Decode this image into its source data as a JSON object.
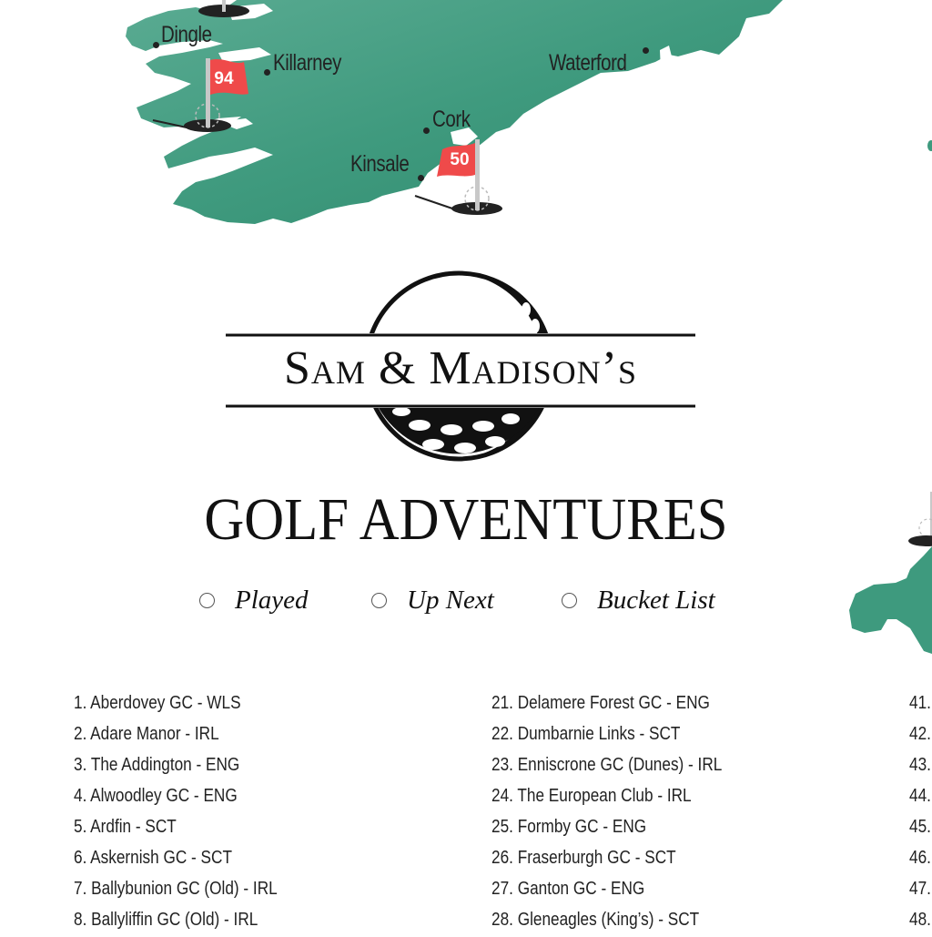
{
  "map": {
    "land_color": "#3e9a7e",
    "flag_color": "#ef4a4a",
    "cities": [
      {
        "name": "Dingle"
      },
      {
        "name": "Killarney"
      },
      {
        "name": "Waterford"
      },
      {
        "name": "Cork"
      },
      {
        "name": "Kinsale"
      }
    ],
    "flags": [
      {
        "number": "94"
      },
      {
        "number": "50"
      }
    ]
  },
  "header": {
    "names": "Sam & Madison’s",
    "title": "GOLF ADVENTURES"
  },
  "legend": [
    {
      "label": "Played",
      "checked": false
    },
    {
      "label": "Up Next",
      "checked": false
    },
    {
      "label": "Bucket List",
      "checked": false
    }
  ],
  "courses": {
    "column1": [
      "1. Aberdovey GC - WLS",
      "2. Adare Manor - IRL",
      "3. The Addington - ENG",
      "4. Alwoodley GC - ENG",
      "5. Ardfin - SCT",
      "6. Askernish GC - SCT",
      "7. Ballybunion GC (Old) - IRL",
      "8. Ballyliffin GC (Old) - IRL"
    ],
    "column2": [
      "21. Delamere Forest GC - ENG",
      "22. Dumbarnie Links - SCT",
      "23. Enniscrone GC (Dunes) - IRL",
      "24. The European Club - IRL",
      "25. Formby GC - ENG",
      "26. Fraserburgh GC - SCT",
      "27. Ganton GC - ENG",
      "28. Gleneagles (King’s) - SCT"
    ],
    "column3": [
      "41.",
      "42.",
      "43.",
      "44.",
      "45.",
      "46.",
      "47.",
      "48."
    ]
  }
}
